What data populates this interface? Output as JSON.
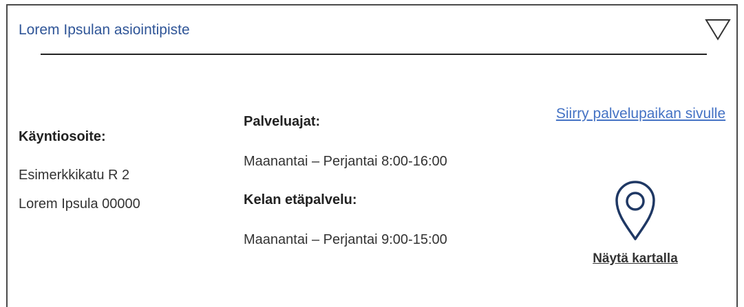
{
  "header": {
    "title": "Lorem Ipsulan asiointipiste",
    "toggle_icon": "triangle-down-outline-icon"
  },
  "visit_address": {
    "label": "Käyntiosoite:",
    "street": "Esimerkkikatu R 2",
    "city": "Lorem Ipsula 00000"
  },
  "service_hours": {
    "label": "Palveluajat:",
    "value": "Maanantai – Perjantai 8:00-16:00"
  },
  "remote_service": {
    "label": "Kelan etäpalvelu:",
    "value": "Maanantai – Perjantai 9:00-15:00"
  },
  "links": {
    "page_link": "Siirry palvelupaikan sivulle",
    "map_link": "Näytä kartalla",
    "map_icon": "map-pin-icon"
  },
  "colors": {
    "title": "#2f5597",
    "link": "#4472c4",
    "pin": "#1f3864",
    "text": "#222222"
  }
}
